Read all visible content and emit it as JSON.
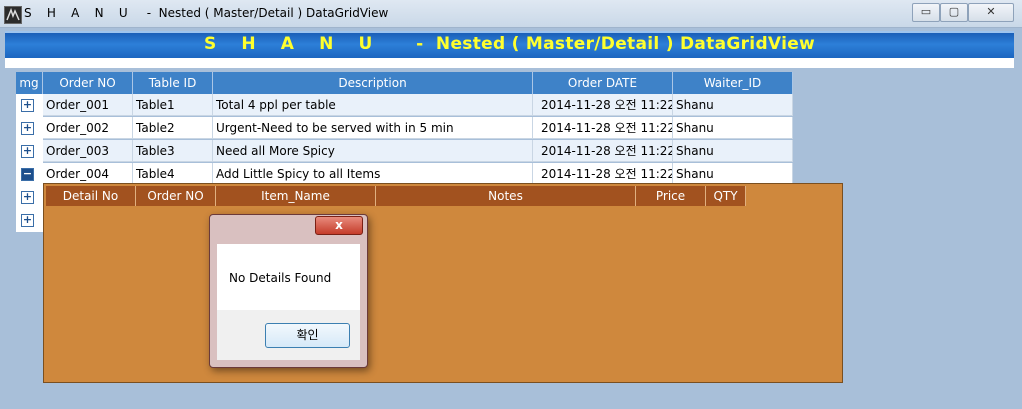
{
  "window": {
    "title": "S    H    A    N    U     -  Nested ( Master/Detail ) DataGridView",
    "controls": {
      "minimize": "▭",
      "maximize": "▢",
      "close": "✕"
    }
  },
  "banner": {
    "title": "S    H    A    N    U       -  Nested ( Master/Detail ) DataGridView",
    "text_color": "#ffff2e"
  },
  "master_grid": {
    "columns": [
      "mg",
      "Order NO",
      "Table ID",
      "Description",
      "Order DATE",
      "Waiter_ID"
    ],
    "rows": [
      {
        "expand": "+",
        "order_no": "Order_001",
        "table_id": "Table1",
        "description": "Total 4 ppl per table",
        "order_date": "2014-11-28 오전 11:22",
        "waiter_id": "Shanu"
      },
      {
        "expand": "+",
        "order_no": "Order_002",
        "table_id": "Table2",
        "description": "Urgent-Need to be served with in 5 min",
        "order_date": "2014-11-28 오전 11:22",
        "waiter_id": "Shanu"
      },
      {
        "expand": "+",
        "order_no": "Order_003",
        "table_id": "Table3",
        "description": "Need all More Spicy",
        "order_date": "2014-11-28 오전 11:22",
        "waiter_id": "Shanu"
      },
      {
        "expand": "−",
        "order_no": "Order_004",
        "table_id": "Table4",
        "description": "Add Little Spicy to all Items",
        "order_date": "2014-11-28 오전 11:22",
        "waiter_id": "Shanu"
      }
    ],
    "extra_expanders": [
      "+",
      "+"
    ]
  },
  "detail_grid": {
    "columns": [
      "Detail No",
      "Order NO",
      "Item_Name",
      "Notes",
      "Price",
      "QTY"
    ]
  },
  "message_box": {
    "close_label": "x",
    "text": "No Details Found",
    "ok_label": "확인"
  }
}
